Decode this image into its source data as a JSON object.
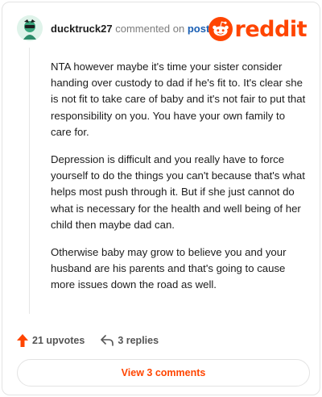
{
  "header": {
    "username": "ducktruck27",
    "action_text": "commented on",
    "post_link": "post",
    "brand": "reddit"
  },
  "comment": {
    "paragraphs": [
      "NTA however maybe it's time your sister consider handing over custody to dad if he's fit to. It's clear she is not fit to take care of baby and it's not fair to put that responsibility on you. You have your own family to care for.",
      "Depression is difficult and you really have to force yourself to do the things you can't because that's what helps most push through it. But if she just cannot do what is necessary for the health and well being of her child then maybe dad can.",
      "Otherwise baby may grow to believe you and your husband are his parents and that's going to cause more issues down the road as well."
    ]
  },
  "actions": {
    "upvotes": "21 upvotes",
    "replies": "3 replies"
  },
  "footer": {
    "view_comments": "View 3 comments"
  },
  "colors": {
    "accent": "#ff4500",
    "link": "#1a5fb4"
  },
  "icons": [
    "avatar",
    "reddit-logo-icon",
    "upvote-arrow-icon",
    "reply-icon"
  ]
}
